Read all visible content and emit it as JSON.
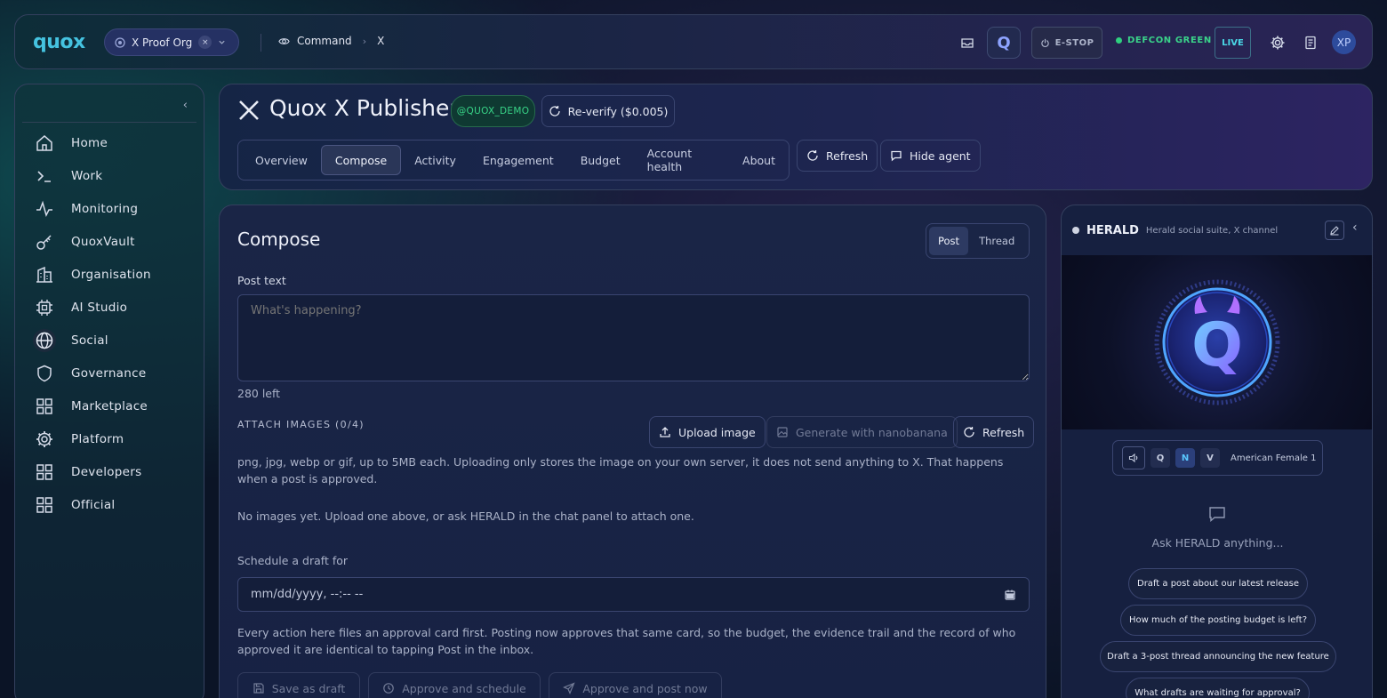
{
  "topbar": {
    "logo": "quox",
    "org": "X Proof Org",
    "org_clear": "×",
    "breadcrumbs": [
      "Command",
      "X"
    ],
    "estop": "E-STOP",
    "defcon": "DEFCON GREEN",
    "live": "LIVE",
    "avatar": "XP",
    "q_logo": "Q"
  },
  "sidebar": {
    "items": [
      {
        "label": "Home",
        "icon": "home-icon"
      },
      {
        "label": "Work",
        "icon": "terminal-icon"
      },
      {
        "label": "Monitoring",
        "icon": "activity-icon"
      },
      {
        "label": "QuoxVault",
        "icon": "key-icon"
      },
      {
        "label": "Organisation",
        "icon": "building-icon"
      },
      {
        "label": "AI Studio",
        "icon": "chip-icon"
      },
      {
        "label": "Social",
        "icon": "globe-icon"
      },
      {
        "label": "Governance",
        "icon": "shield-icon"
      },
      {
        "label": "Marketplace",
        "icon": "grid-icon"
      },
      {
        "label": "Platform",
        "icon": "gear-icon"
      },
      {
        "label": "Developers",
        "icon": "grid-icon"
      },
      {
        "label": "Official",
        "icon": "grid-icon"
      }
    ]
  },
  "header": {
    "title": "Quox X Publisher",
    "handle": "@QUOX_DEMO",
    "reverify": "Re-verify ($0.005)",
    "tabs": [
      "Overview",
      "Compose",
      "Activity",
      "Engagement",
      "Budget",
      "Account health",
      "About"
    ],
    "active_tab": "Compose",
    "refresh": "Refresh",
    "hide_agent": "Hide agent"
  },
  "compose": {
    "title": "Compose",
    "modes": [
      "Post",
      "Thread"
    ],
    "active_mode": "Post",
    "post_label": "Post text",
    "post_placeholder": "What's happening?",
    "post_value": "",
    "chars_left": "280 left",
    "attach_label": "ATTACH IMAGES (0/4)",
    "upload": "Upload image",
    "generate": "Generate with nanobanana",
    "refresh": "Refresh",
    "upload_note": "png, jpg, webp or gif, up to 5MB each. Uploading only stores the image on your own server, it does not send anything to X. That happens when a post is approved.",
    "no_images": "No images yet. Upload one above, or ask HERALD in the chat panel to attach one.",
    "schedule_label": "Schedule a draft for",
    "schedule_value": "mm/dd/yyyy, --:-- --",
    "approval_note": "Every action here files an approval card first. Posting now approves that same card, so the budget, the evidence trail and the record of who approved it are identical to tapping Post in the inbox.",
    "save_draft": "Save as draft",
    "approve_schedule": "Approve and schedule",
    "approve_post": "Approve and post now"
  },
  "herald": {
    "name": "HERALD",
    "subtitle": "Herald social suite, X channel",
    "avatar_letter": "Q",
    "voice_keys": [
      "Q",
      "N",
      "V"
    ],
    "active_voice_key": "N",
    "voice_name": "American Female 1",
    "ask": "Ask HERALD anything...",
    "suggestions": [
      "Draft a post about our latest release",
      "How much of the posting budget is left?",
      "Draft a 3-post thread announcing the new feature",
      "What drafts are waiting for approval?"
    ]
  },
  "colors": {
    "accent": "#45c3e0",
    "success": "#2fd07f",
    "handle": "#38d487",
    "live": "#4ad8e6"
  }
}
